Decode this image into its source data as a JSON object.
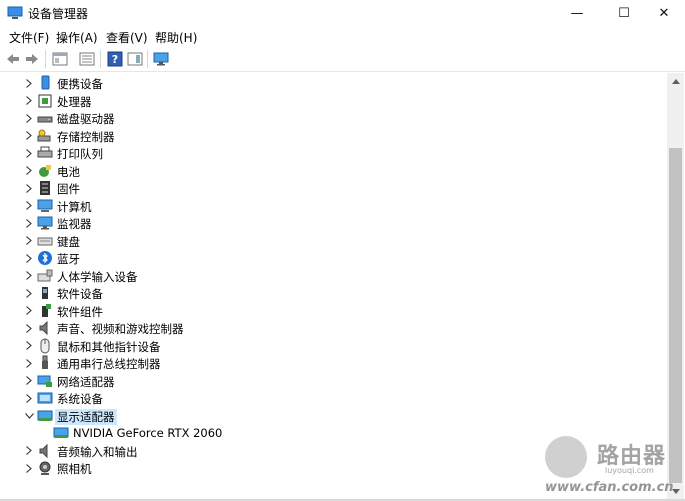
{
  "window": {
    "title": "设备管理器",
    "minimize": "—",
    "maximize": "☐",
    "close": "✕"
  },
  "menu": [
    "文件(F)",
    "操作(A)",
    "查看(V)",
    "帮助(H)"
  ],
  "toolbar": {
    "buttons": [
      "back-arrow-icon",
      "forward-arrow-icon",
      "properties-icon",
      "device-list-icon",
      "help-icon",
      "action-pane-icon",
      "monitor-icon"
    ]
  },
  "tree": [
    {
      "label": "便携设备",
      "icon": "portable-device-icon",
      "expanded": false,
      "level": 1
    },
    {
      "label": "处理器",
      "icon": "processor-icon",
      "expanded": false,
      "level": 1
    },
    {
      "label": "磁盘驱动器",
      "icon": "disk-drive-icon",
      "expanded": false,
      "level": 1
    },
    {
      "label": "存储控制器",
      "icon": "storage-controller-icon",
      "expanded": false,
      "level": 1
    },
    {
      "label": "打印队列",
      "icon": "printer-icon",
      "expanded": false,
      "level": 1
    },
    {
      "label": "电池",
      "icon": "battery-icon",
      "expanded": false,
      "level": 1
    },
    {
      "label": "固件",
      "icon": "firmware-icon",
      "expanded": false,
      "level": 1
    },
    {
      "label": "计算机",
      "icon": "computer-icon",
      "expanded": false,
      "level": 1
    },
    {
      "label": "监视器",
      "icon": "monitor-icon",
      "expanded": false,
      "level": 1
    },
    {
      "label": "键盘",
      "icon": "keyboard-icon",
      "expanded": false,
      "level": 1
    },
    {
      "label": "蓝牙",
      "icon": "bluetooth-icon",
      "expanded": false,
      "level": 1
    },
    {
      "label": "人体学输入设备",
      "icon": "hid-icon",
      "expanded": false,
      "level": 1
    },
    {
      "label": "软件设备",
      "icon": "software-device-icon",
      "expanded": false,
      "level": 1
    },
    {
      "label": "软件组件",
      "icon": "software-component-icon",
      "expanded": false,
      "level": 1
    },
    {
      "label": "声音、视频和游戏控制器",
      "icon": "speaker-icon",
      "expanded": false,
      "level": 1
    },
    {
      "label": "鼠标和其他指针设备",
      "icon": "mouse-icon",
      "expanded": false,
      "level": 1
    },
    {
      "label": "通用串行总线控制器",
      "icon": "usb-icon",
      "expanded": false,
      "level": 1
    },
    {
      "label": "网络适配器",
      "icon": "network-adapter-icon",
      "expanded": false,
      "level": 1
    },
    {
      "label": "系统设备",
      "icon": "system-device-icon",
      "expanded": false,
      "level": 1
    },
    {
      "label": "显示适配器",
      "icon": "display-adapter-icon",
      "expanded": true,
      "level": 1,
      "selected": true
    },
    {
      "label": "NVIDIA GeForce RTX 2060",
      "icon": "display-adapter-icon",
      "level": 2
    },
    {
      "label": "音频输入和输出",
      "icon": "audio-io-icon",
      "expanded": false,
      "level": 1
    },
    {
      "label": "照相机",
      "icon": "camera-icon",
      "expanded": false,
      "level": 1
    }
  ],
  "watermark": {
    "title": "路由器",
    "subtitle": "luyouqi.com",
    "url": "www.cfan.com.cn"
  },
  "colors": {
    "selection": "#cce8ff",
    "accent": "#0078d7"
  }
}
